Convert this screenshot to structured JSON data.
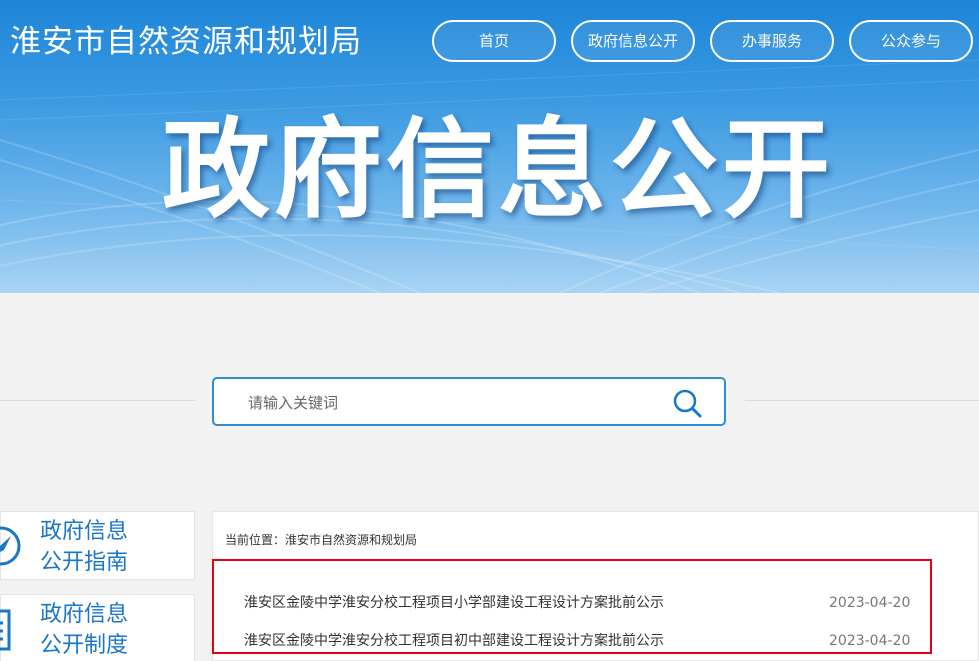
{
  "header": {
    "site_title": "淮安市自然资源和规划局",
    "nav": [
      "首页",
      "政府信息公开",
      "办事服务",
      "公众参与"
    ],
    "hero_title": "政府信息公开"
  },
  "search": {
    "placeholder": "请输入关键词",
    "icon": "search-icon"
  },
  "sidebar": {
    "items": [
      {
        "line1": "政府信息",
        "line2": "公开指南",
        "icon": "compass-icon"
      },
      {
        "line1": "政府信息",
        "line2": "公开制度",
        "icon": "document-icon"
      }
    ]
  },
  "content": {
    "breadcrumb": "当前位置：淮安市自然资源和规划局",
    "list": [
      {
        "title": "淮安区金陵中学淮安分校工程项目小学部建设工程设计方案批前公示",
        "date": "2023-04-20"
      },
      {
        "title": "淮安区金陵中学淮安分校工程项目初中部建设工程设计方案批前公示",
        "date": "2023-04-20"
      }
    ],
    "highlight_color": "#e60012"
  },
  "colors": {
    "accent": "#1a76c6",
    "search_border": "#2b8fd6"
  }
}
